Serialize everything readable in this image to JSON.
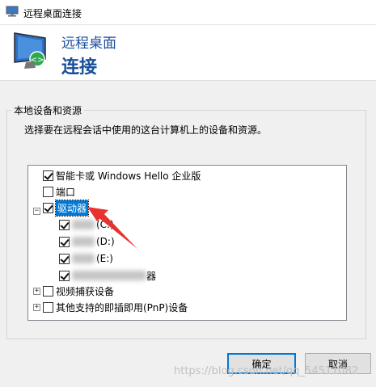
{
  "window": {
    "title": "远程桌面连接"
  },
  "header": {
    "line1": "远程桌面",
    "line2": "连接"
  },
  "group": {
    "legend": "本地设备和资源",
    "description": "选择要在远程会话中使用的这台计算机上的设备和资源。"
  },
  "tree": {
    "smartcard": {
      "label": "智能卡或 Windows Hello 企业版",
      "checked": true
    },
    "ports": {
      "label": "端口",
      "checked": false
    },
    "drives": {
      "label": "驱动器",
      "checked": true,
      "expanded": true,
      "children": [
        {
          "label": "(C:)",
          "checked": true
        },
        {
          "label": "(D:)",
          "checked": true
        },
        {
          "label": "(E:)",
          "checked": true
        },
        {
          "label": "器",
          "checked": true
        }
      ]
    },
    "video": {
      "label": "视频捕获设备",
      "checked": false
    },
    "pnp": {
      "label": "其他支持的即插即用(PnP)设备",
      "checked": false
    }
  },
  "buttons": {
    "ok": "确定",
    "cancel": "取消"
  },
  "watermark": "https://blog.csdn.net/qq_54511082",
  "colors": {
    "accent": "#0078d7",
    "heading": "#1a4f9a",
    "annotation_arrow": "#e8322f"
  }
}
